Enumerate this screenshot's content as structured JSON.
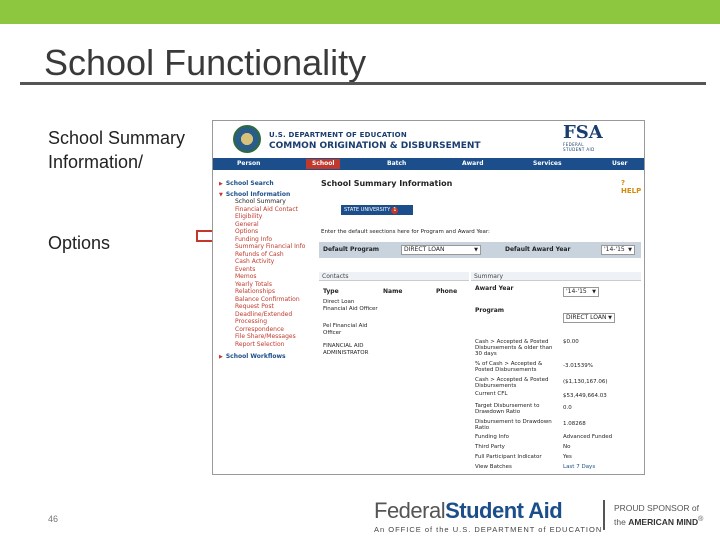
{
  "slide": {
    "title": "School Functionality",
    "left_text_1": "School Summary Information/",
    "left_text_2": "Options",
    "page_number": "46"
  },
  "app": {
    "dept_small": "U.S. DEPARTMENT OF EDUCATION",
    "dept_big": "COMMON ORIGINATION & DISBURSEMENT",
    "fsa_logo": "FSA",
    "fsa_logo_sub1": "FEDERAL",
    "fsa_logo_sub2": "STUDENT AID",
    "nav": [
      "Person",
      "School",
      "Batch",
      "Award",
      "Services",
      "User"
    ],
    "nav_active": "School"
  },
  "sidebar": {
    "school_search": "School Search",
    "school_information": "School Information",
    "items": [
      "School Summary",
      "Financial Aid Contact",
      "Eligibility",
      "General",
      "Options",
      "Funding Info",
      "Summary Financial Info",
      "Refunds of Cash",
      "Cash Activity",
      "Events",
      "Memos",
      "Yearly Totals",
      "Relationships",
      "Balance Confirmation",
      "Request Post",
      "Deadline/Extended",
      "Processing",
      "Correspondence",
      "File Share/Messages",
      "Report Selection"
    ],
    "school_workflows": "School Workflows"
  },
  "main": {
    "title": "School Summary Information",
    "help": "HELP",
    "school_name": "STATE UNIVERSITY",
    "badge": "1",
    "instruction": "Enter the default seections here for Program and Award Year:",
    "default_program_label": "Default Program",
    "default_program_value": "DIRECT LOAN",
    "default_award_year_label": "Default Award Year",
    "default_award_year_value": "'14-'15"
  },
  "contacts": {
    "header": "Contacts",
    "col_type": "Type",
    "col_name": "Name",
    "col_phone": "Phone",
    "types": [
      "Direct Loan Financial Aid Officer",
      "Pel Financial Aid Officer",
      "FINANCIAL AID ADMINISTRATOR"
    ]
  },
  "summary": {
    "header": "Summary",
    "award_year_label": "Award Year",
    "award_year_value": "'14-'15",
    "program_label": "Program",
    "program_value": "DIRECT LOAN",
    "rows": [
      {
        "label": "Cash > Accepted & Posted Disbursements & older than 30 days",
        "value": "$0.00"
      },
      {
        "label": "% of Cash > Accepted & Posted Disbursements",
        "value": "-3.01539%"
      },
      {
        "label": "Cash > Accepted & Posted Disbursements",
        "value": "($1,130,167.06)"
      },
      {
        "label": "Current CFL",
        "value": "$53,449,664.03"
      },
      {
        "label": "Target Disbursement to Drawdown Ratio",
        "value": "0.0"
      },
      {
        "label": "Disbursement to Drawdown Ratio",
        "value": "1.08268"
      },
      {
        "label": "Funding Info",
        "value": "Advanced Funded"
      },
      {
        "label": "Third Party",
        "value": "No"
      },
      {
        "label": "Full Participant Indicator",
        "value": "Yes"
      },
      {
        "label": "View Batches",
        "value": "Last 7 Days"
      }
    ]
  },
  "footer": {
    "fsa_name_plain": "Federal",
    "fsa_name_bold": "Student Aid",
    "fsa_sub": "An OFFICE of the U.S. DEPARTMENT of EDUCATION",
    "proud_line1": "PROUD SPONSOR of",
    "proud_line2_pre": "the",
    "proud_line2_bold": "AMERICAN MIND",
    "proud_mark": "®"
  },
  "colors": {
    "top_bar": "#8dc63f",
    "nav_bar": "#1b4e8a",
    "nav_active": "#c0392b",
    "arrow": "#c0392b"
  }
}
